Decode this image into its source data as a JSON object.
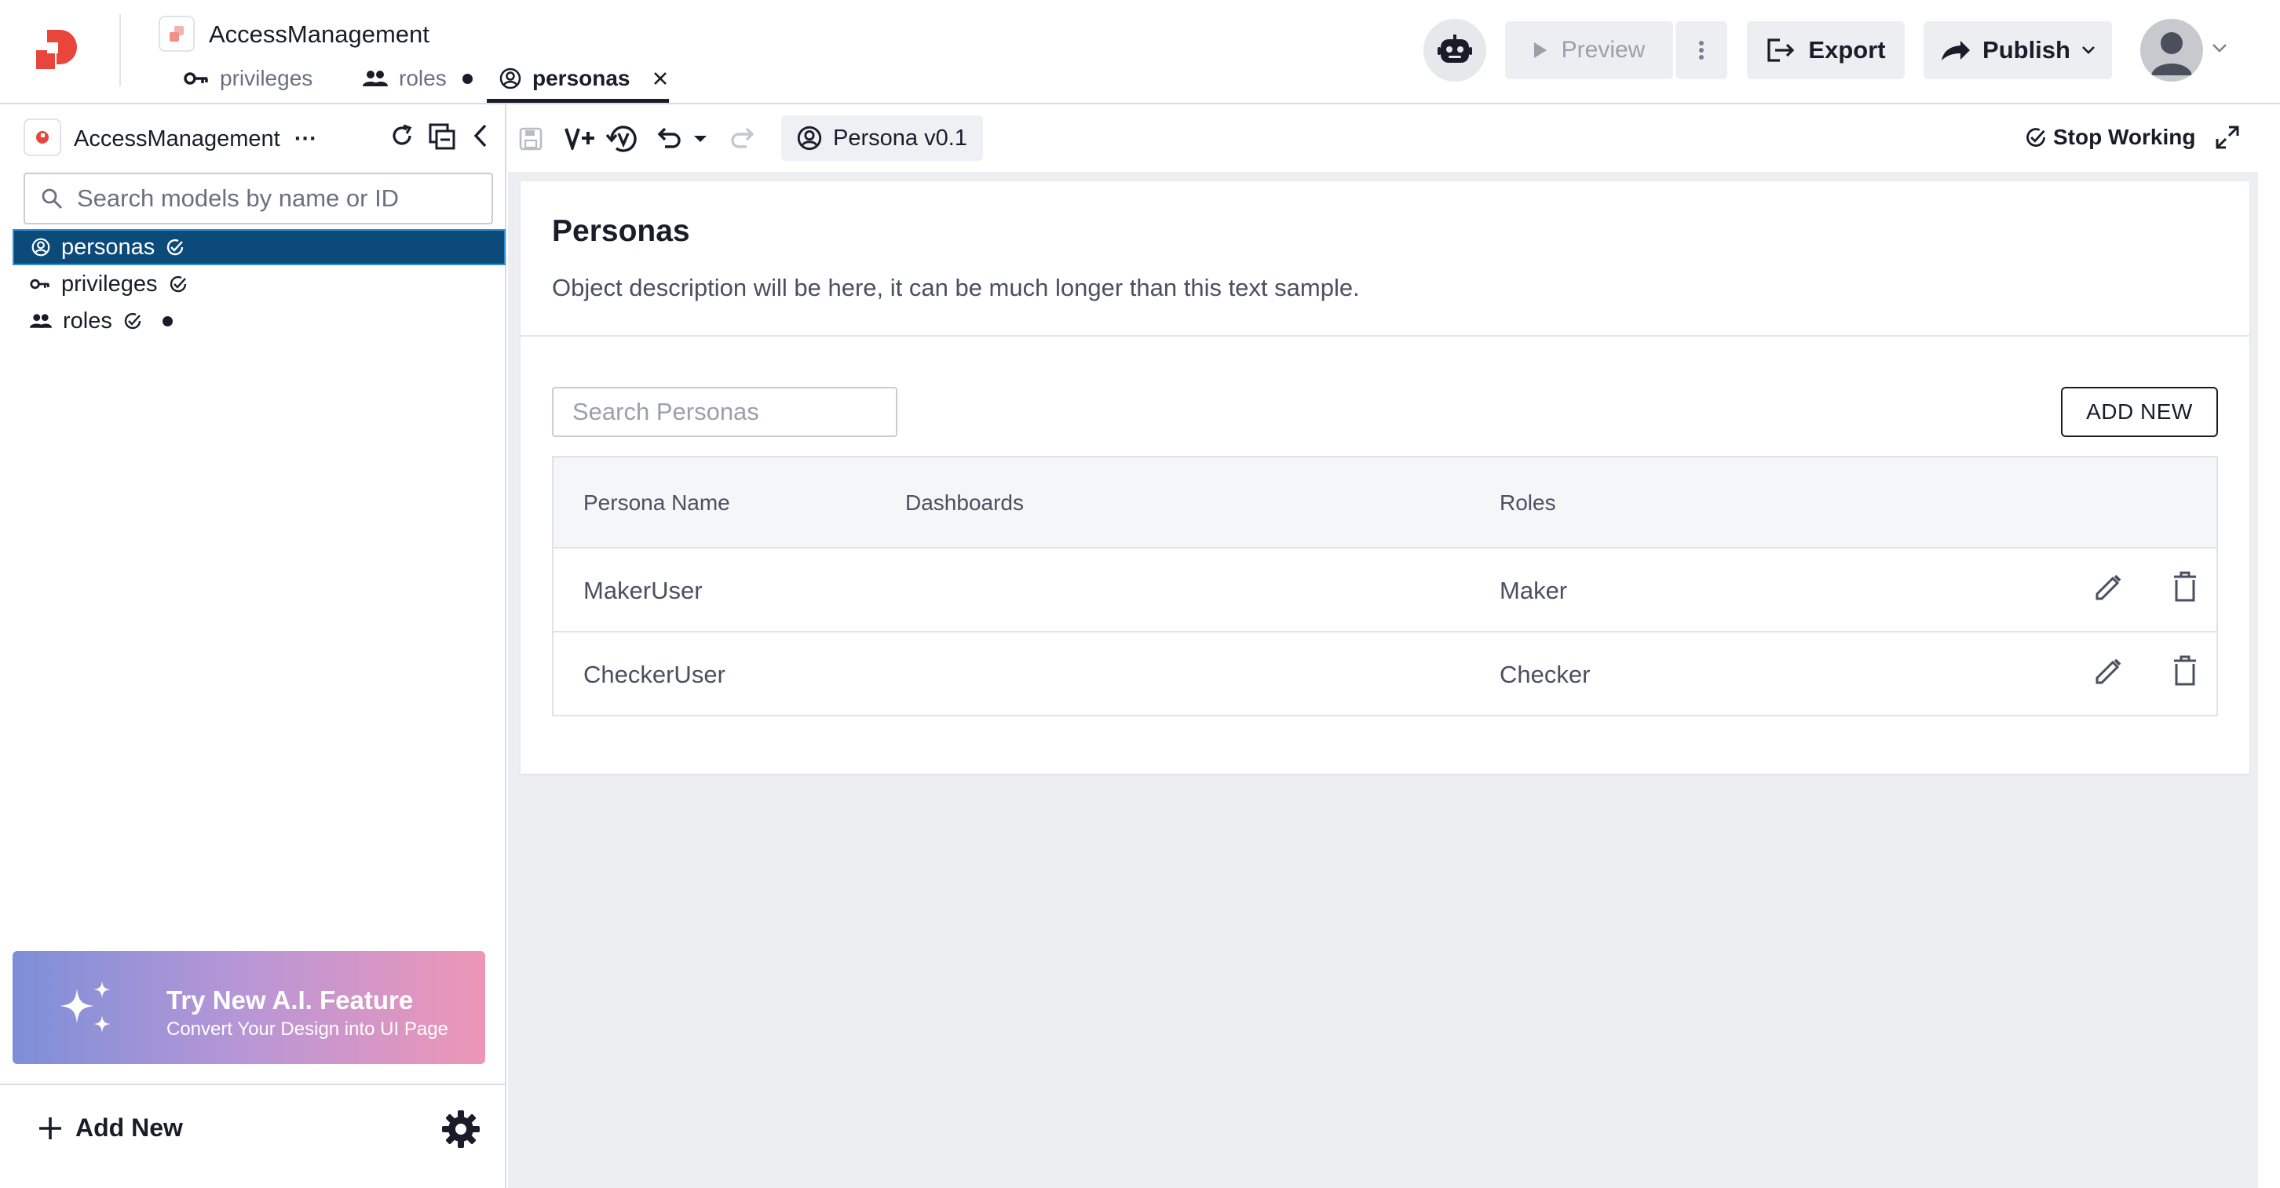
{
  "app": {
    "title": "AccessManagement",
    "tabs": [
      {
        "label": "privileges",
        "icon": "key-icon",
        "modified": false,
        "active": false
      },
      {
        "label": "roles",
        "icon": "group-icon",
        "modified": true,
        "active": false
      },
      {
        "label": "personas",
        "icon": "person-circle-icon",
        "modified": false,
        "active": true,
        "closable": true
      }
    ]
  },
  "header": {
    "preview_label": "Preview",
    "export_label": "Export",
    "publish_label": "Publish"
  },
  "sidebar": {
    "project_name": "AccessManagement",
    "project_more": "···",
    "search_placeholder": "Search models by name or ID",
    "items": [
      {
        "label": "personas",
        "icon": "person-circle-icon",
        "selected": true,
        "modified": false
      },
      {
        "label": "privileges",
        "icon": "key-icon",
        "selected": false,
        "modified": false
      },
      {
        "label": "roles",
        "icon": "group-icon",
        "selected": false,
        "modified": true
      }
    ],
    "ai_banner": {
      "title": "Try New A.I. Feature",
      "subtitle": "Convert Your Design into UI Page"
    },
    "add_new_label": "Add New"
  },
  "toolbar": {
    "version_label": "Persona v0.1",
    "stop_working_label": "Stop Working"
  },
  "main": {
    "title": "Personas",
    "description": "Object description will be here, it can be much longer than this text sample.",
    "search_placeholder": "Search Personas",
    "add_new_label": "ADD NEW",
    "table": {
      "columns": [
        "Persona Name",
        "Dashboards",
        "Roles"
      ],
      "rows": [
        {
          "name": "MakerUser",
          "dashboards": "",
          "roles": "Maker"
        },
        {
          "name": "CheckerUser",
          "dashboards": "",
          "roles": "Checker"
        }
      ]
    }
  },
  "colors": {
    "accent": "#e8453c",
    "selected_bg": "#0c4a7a",
    "text": "#1a1d29"
  }
}
